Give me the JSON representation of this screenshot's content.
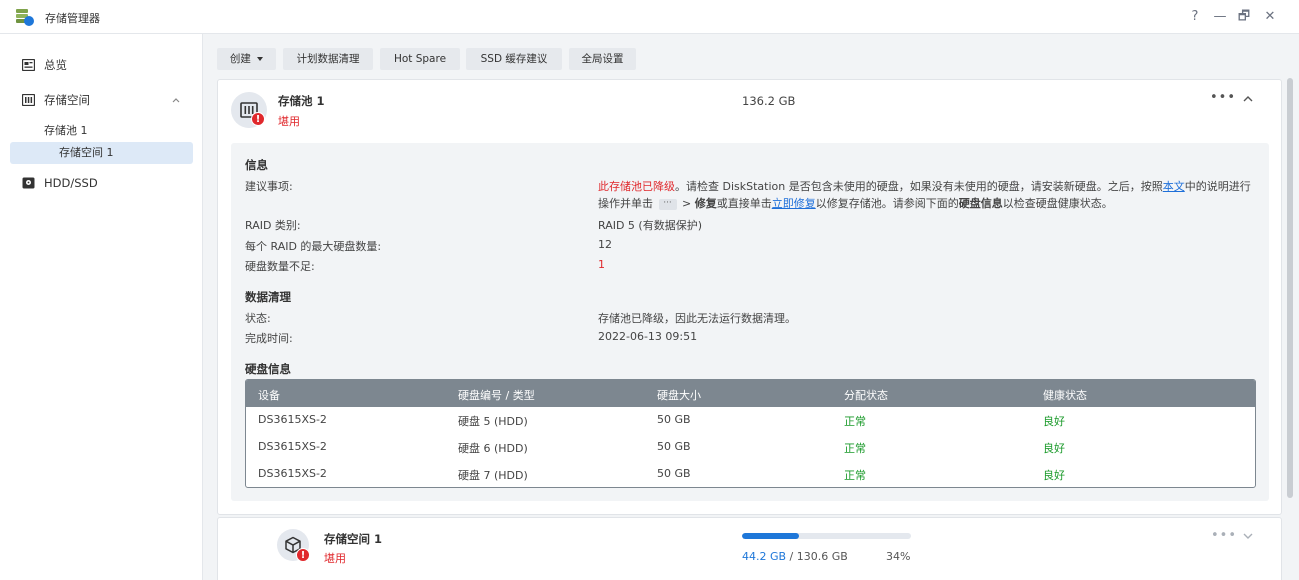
{
  "window": {
    "title": "存储管理器",
    "controls": {
      "help": "?",
      "minimize": "—",
      "restore": "🗗",
      "close": "✕"
    }
  },
  "sidebar": {
    "items": [
      {
        "label": "总览",
        "icon": "overview-icon"
      },
      {
        "label": "存储空间",
        "icon": "storage-icon",
        "expanded": true
      },
      {
        "label": "存储池 1"
      },
      {
        "label": "存储空间 1",
        "selected": true
      },
      {
        "label": "HDD/SSD",
        "icon": "disk-icon"
      }
    ]
  },
  "toolbar": {
    "create": "创建",
    "scrub": "计划数据清理",
    "hotspare": "Hot Spare",
    "ssd_cache": "SSD 缓存建议",
    "global": "全局设置"
  },
  "pool": {
    "name": "存储池 1",
    "status": "堪用",
    "size": "136.2 GB",
    "info": {
      "title": "信息",
      "suggestion_label": "建议事项:",
      "suggestion": {
        "red": "此存储池已降级",
        "t1": "。请检查 DiskStation 是否包含未使用的硬盘，如果没有未使用的硬盘，请安装新硬盘。之后，按照",
        "link1": "本文",
        "t2": "中的说明进行",
        "t3": "操作并单击",
        "chip": "···",
        "t4": "> ",
        "bold1": "修复",
        "t5": "或直接单击",
        "link2": "立即修复",
        "t6": "以修复存储池。请参阅下面的",
        "bold2": "硬盘信息",
        "t7": "以检查硬盘健康状态。"
      },
      "raid_label": "RAID 类别:",
      "raid_value": "RAID 5 (有数据保护)",
      "max_label": "每个 RAID 的最大硬盘数量:",
      "max_value": "12",
      "missing_label": "硬盘数量不足:",
      "missing_value": "1"
    },
    "scrub": {
      "title": "数据清理",
      "status_label": "状态:",
      "status_value": "存储池已降级，因此无法运行数据清理。",
      "time_label": "完成时间:",
      "time_value": "2022-06-13 09:51"
    },
    "disks": {
      "title": "硬盘信息",
      "columns": [
        "设备",
        "硬盘编号 / 类型",
        "硬盘大小",
        "分配状态",
        "健康状态"
      ],
      "rows": [
        {
          "device": "DS3615XS-2",
          "disk": "硬盘 5 (HDD)",
          "size": "50 GB",
          "alloc": "正常",
          "health": "良好"
        },
        {
          "device": "DS3615XS-2",
          "disk": "硬盘 6 (HDD)",
          "size": "50 GB",
          "alloc": "正常",
          "health": "良好"
        },
        {
          "device": "DS3615XS-2",
          "disk": "硬盘 7 (HDD)",
          "size": "50 GB",
          "alloc": "正常",
          "health": "良好"
        }
      ]
    }
  },
  "volume": {
    "name": "存储空间 1",
    "status": "堪用",
    "used": "44.2 GB",
    "total": " / 130.6 GB",
    "percent_label": "34%",
    "usage_fraction": 0.34
  },
  "colors": {
    "accent": "#1e77d9",
    "danger": "#e0282c",
    "ok": "#1a9a2a",
    "table_header": "#7d8790"
  }
}
